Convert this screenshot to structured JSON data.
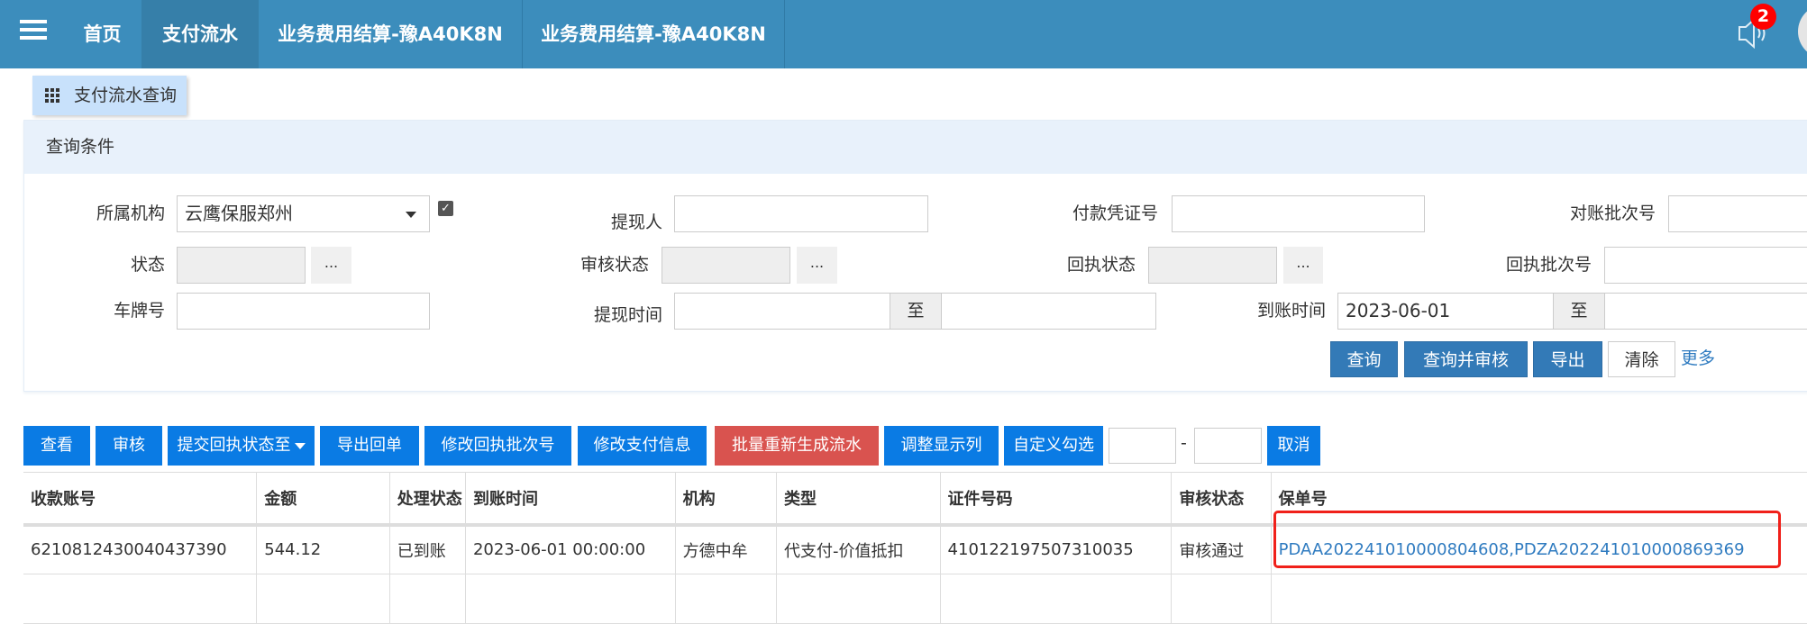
{
  "topbar": {
    "tabs": [
      "首页",
      "支付流水",
      "业务费用结算-豫A40K8N",
      "业务费用结算-豫A40K8N"
    ],
    "notification_count": "2"
  },
  "page_tab": "支付流水查询",
  "query": {
    "title": "查询条件",
    "fields": {
      "org_label": "所属机构",
      "org_value": "云鹰保服郑州",
      "withdrawer_label": "提现人",
      "voucher_label": "付款凭证号",
      "recon_batch_label": "对账批次号",
      "status_label": "状态",
      "audit_status_label": "审核状态",
      "receipt_status_label": "回执状态",
      "receipt_batch_label": "回执批次号",
      "plate_label": "车牌号",
      "withdraw_time_label": "提现时间",
      "arrival_time_label": "到账时间",
      "arrival_from": "2023-06-01",
      "to_label": "至",
      "dots": "..."
    },
    "buttons": {
      "search": "查询",
      "search_audit": "查询并审核",
      "export": "导出",
      "clear": "清除",
      "more": "更多"
    }
  },
  "actions": [
    "查看",
    "审核",
    "提交回执状态至",
    "导出回单",
    "修改回执批次号",
    "修改支付信息",
    "批量重新生成流水",
    "调整显示列",
    "自定义勾选"
  ],
  "range_dash": "-",
  "cancel": "取消",
  "table": {
    "headers": [
      "收款账号",
      "金额",
      "处理状态",
      "到账时间",
      "机构",
      "类型",
      "证件号码",
      "审核状态",
      "保单号"
    ],
    "rows": [
      [
        "6210812430040437390",
        "544.12",
        "已到账",
        "2023-06-01 00:00:00",
        "方德中牟",
        "代支付-价值抵扣",
        "410122197507310035",
        "审核通过",
        "PDAA202241010000804608,PDZA202241010000869369"
      ]
    ]
  }
}
